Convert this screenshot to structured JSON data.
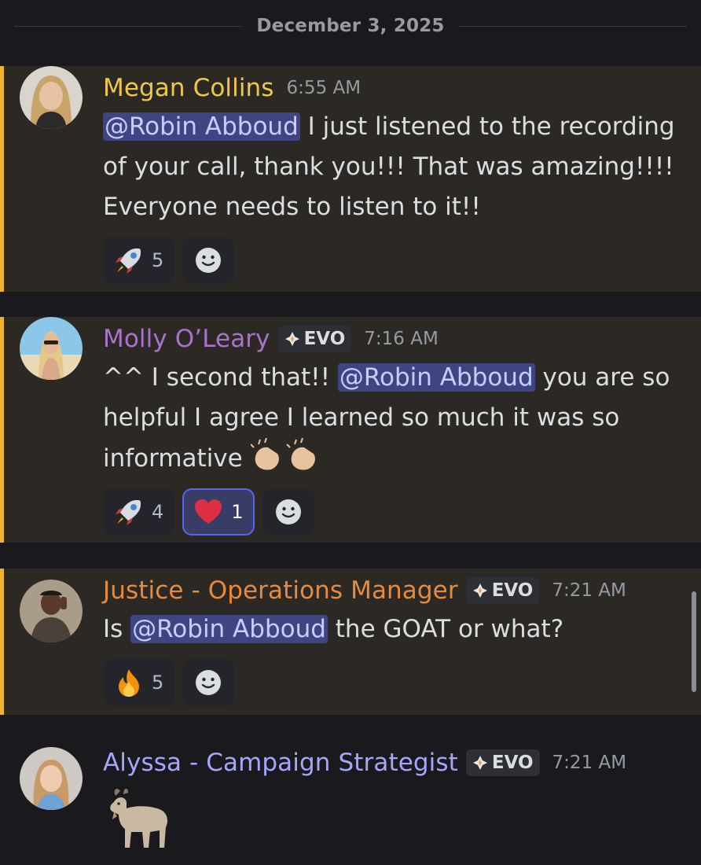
{
  "date_divider": "December 3, 2025",
  "colors": {
    "mention_highlight_bar": "#f0b232",
    "mention_background": "#2c2925",
    "mention_pill": "#3f4583",
    "megan_name": "#f0c847",
    "molly_name": "#a973c9",
    "justice_name": "#e88a3c",
    "alyssa_name": "#a3a6ff"
  },
  "messages": [
    {
      "author": "Megan Collins",
      "time": "6:55 AM",
      "mention": "@Robin Abboud",
      "text_after": " I just listened to the recording of your call, thank you!!! That was amazing!!!! Everyone needs to listen to it!!",
      "reactions": [
        {
          "emoji": "rocket-emoji",
          "count": "5"
        }
      ]
    },
    {
      "author": "Molly O’Leary",
      "badge": "EVO",
      "time": "7:16 AM",
      "text_before": "^^ I second that!! ",
      "mention": "@Robin Abboud",
      "text_after": " you are so helpful I agree I learned so much it was so informative ",
      "reactions": [
        {
          "emoji": "rocket-emoji",
          "count": "4"
        },
        {
          "emoji": "heart-emoji",
          "count": "1",
          "active": true
        }
      ]
    },
    {
      "author": "Justice - Operations Manager",
      "badge": "EVO",
      "time": "7:21 AM",
      "text_before": "Is ",
      "mention": "@Robin Abboud",
      "text_after": " the GOAT or what?",
      "reactions": [
        {
          "emoji": "fire-emoji",
          "count": "5"
        }
      ]
    },
    {
      "author": "Alyssa - Campaign Strategist",
      "badge": "EVO",
      "time": "7:21 AM",
      "content_emoji": "goat-emoji"
    }
  ]
}
